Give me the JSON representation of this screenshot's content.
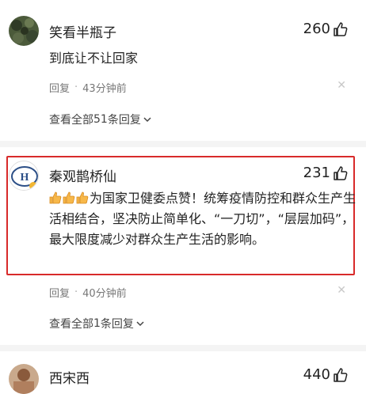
{
  "comments": [
    {
      "user": "笑看半瓶子",
      "likes": "260",
      "text": "到底让不让回家",
      "reply_label": "回复",
      "time": "43分钟前",
      "replies_prefix": "查看全部 ",
      "replies_count": "51",
      "replies_suffix": " 条回复"
    },
    {
      "user": "秦观鹊桥仙",
      "likes": "231",
      "text": "为国家卫健委点赞！统筹疫情防控和群众生产生活相结合，坚决防止简单化、“一刀切”，“层层加码”，最大限度减少对群众生产生活的影响。",
      "reply_label": "回复",
      "time": "40分钟前",
      "replies_prefix": "查看全部 ",
      "replies_count": "1",
      "replies_suffix": " 条回复"
    },
    {
      "user": "西宋西",
      "likes": "440"
    }
  ],
  "colors": {
    "highlight_border": "#d82a2a",
    "meta_text": "#777777"
  }
}
